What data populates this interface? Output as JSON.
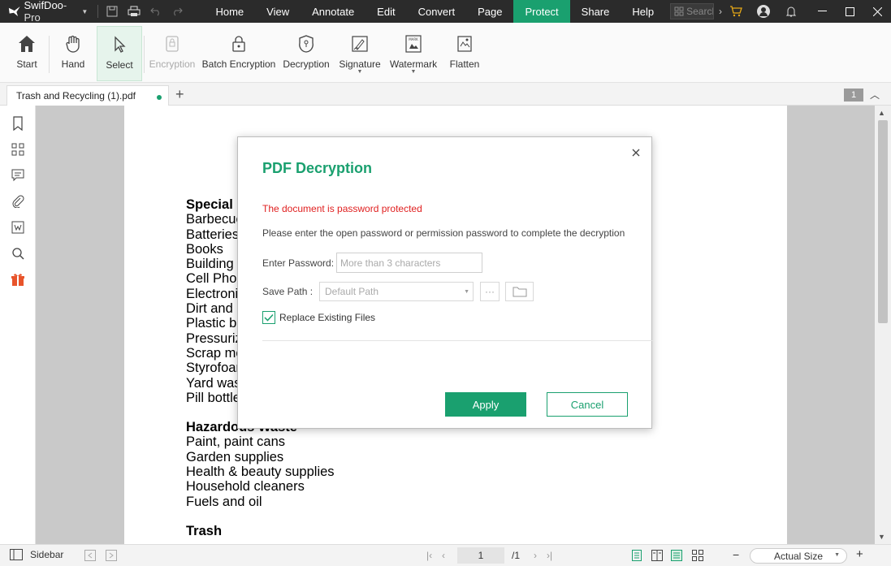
{
  "app": {
    "name": "SwifDoo",
    "name_suffix": "-Pro"
  },
  "menu": [
    "Home",
    "View",
    "Annotate",
    "Edit",
    "Convert",
    "Page",
    "Protect",
    "Share",
    "Help"
  ],
  "menu_active": "Protect",
  "search": {
    "placeholder": "Search"
  },
  "ribbon": {
    "start": "Start",
    "hand": "Hand",
    "select": "Select",
    "encryption": "Encryption",
    "batch_encryption": "Batch Encryption",
    "decryption": "Decryption",
    "signature": "Signature",
    "watermark": "Watermark",
    "flatten": "Flatten"
  },
  "tab": {
    "filename": "Trash and Recycling (1).pdf",
    "page_count_badge": "1"
  },
  "document": {
    "block1": [
      "Special I",
      "Barbecue",
      "Batteries",
      "Books",
      "Building m",
      "Cell Phor",
      "Electronic",
      "Dirt and S",
      "Plastic ba",
      "Pressuriz",
      "Scrap me",
      "Styrofoar",
      "Yard was",
      "Pill bottle"
    ],
    "hazard_heading": "Hazardous Waste",
    "block2": [
      "Paint, paint cans",
      "Garden supplies",
      "Health & beauty supplies",
      "Household cleaners",
      "Fuels and oil"
    ],
    "trash_heading": "Trash"
  },
  "dialog": {
    "title": "PDF Decryption",
    "warning": "The document is password protected",
    "info": "Please enter the open password or permission password to complete the decryption",
    "password_label": "Enter Password:",
    "password_placeholder": "More than 3 characters",
    "save_path_label": "Save Path :",
    "save_path_value": "Default Path",
    "browse_label": "···",
    "replace_label": "Replace Existing Files",
    "replace_checked": true,
    "apply": "Apply",
    "cancel": "Cancel"
  },
  "statusbar": {
    "sidebar_label": "Sidebar",
    "current_page": "1",
    "total_pages": "/1",
    "zoom": "Actual Size"
  },
  "colors": {
    "accent": "#1aa06f",
    "titlebar": "#2b2b2b",
    "warning": "#e02020"
  }
}
